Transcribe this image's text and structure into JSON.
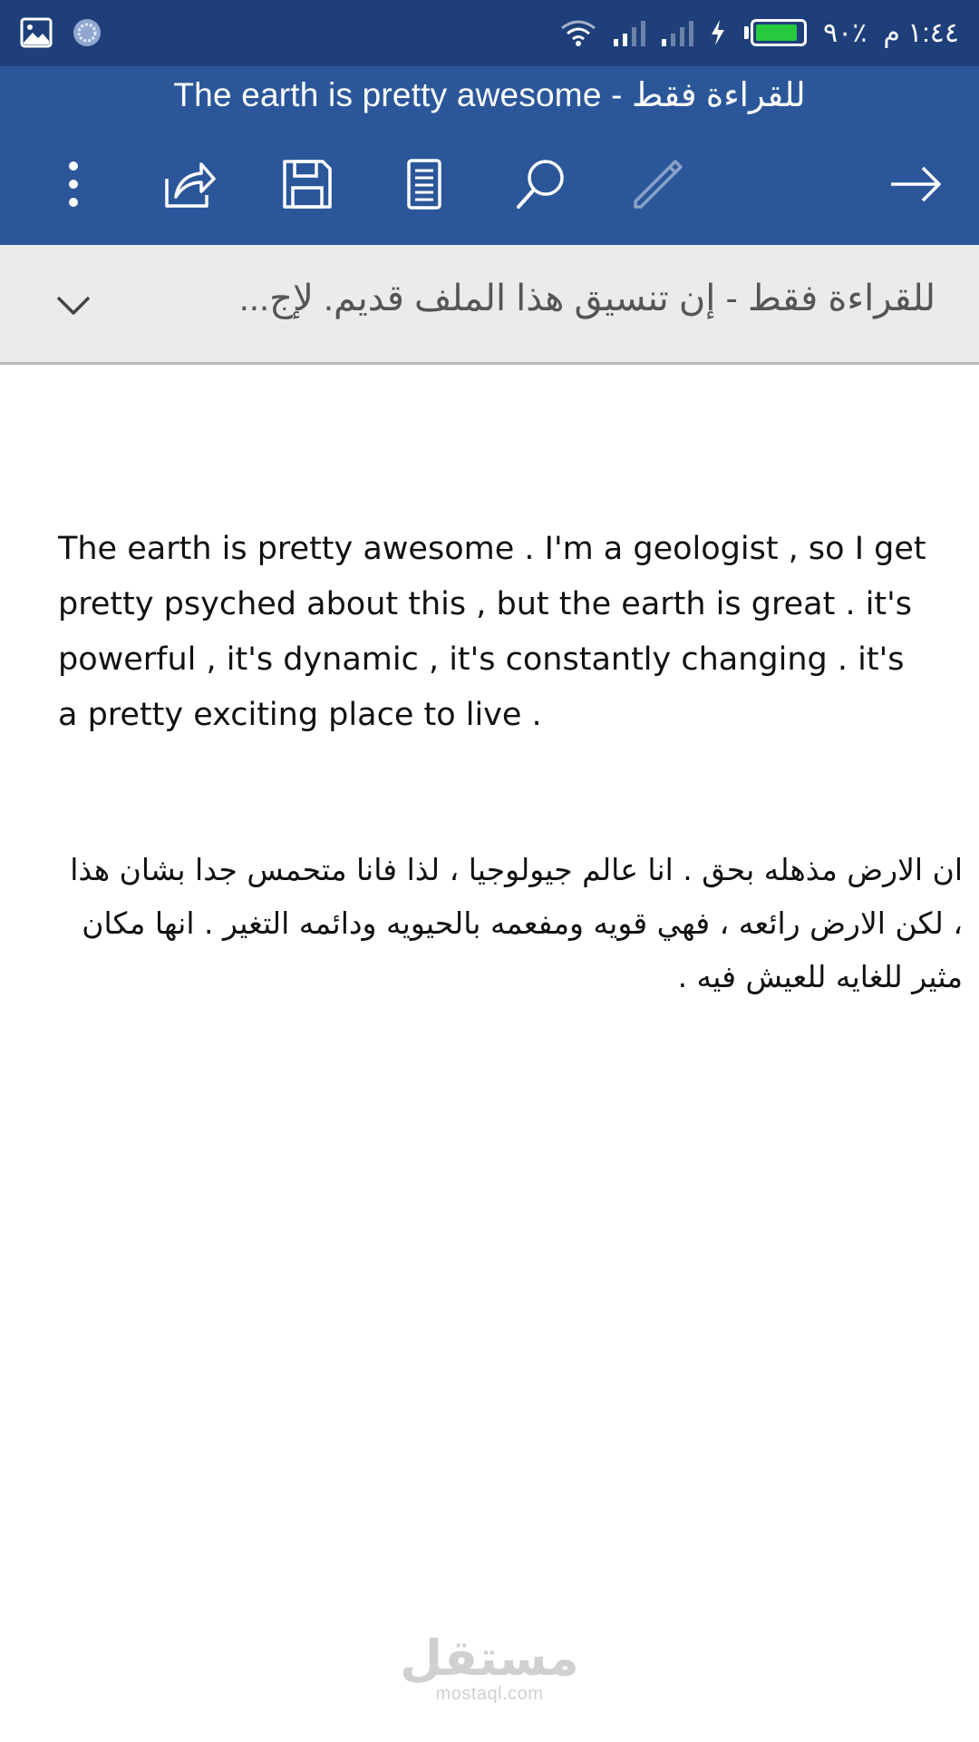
{
  "status_bar": {
    "time": "١:٤٤ م",
    "battery_percent": "٩٠٪",
    "battery_level": 0.9,
    "battery_color": "#27c93f",
    "icons": [
      "gallery-icon",
      "app-badge-icon",
      "wifi-icon",
      "signal-icon",
      "charging-icon",
      "battery-icon"
    ]
  },
  "app_bar": {
    "title": "The earth is pretty awesome - للقراءة فقط",
    "color": "#2b579a",
    "toolbar_icons": [
      "more-options-icon",
      "share-icon",
      "save-icon",
      "mobile-view-icon",
      "search-icon",
      "edit-icon",
      "back-arrow-icon"
    ]
  },
  "readonly_banner": {
    "message": "للقراءة فقط - إن تنسيق هذا الملف قديم. لإج..."
  },
  "document": {
    "paragraph_en": "The earth is pretty awesome . I'm a geologist , so I get pretty psyched about this , but the earth is great . it's powerful , it's dynamic , it's constantly changing . it's a pretty exciting place to live .",
    "paragraph_ar": "ان الارض مذهله بحق . انا عالم جيولوجيا ، لذا فانا متحمس جدا بشان هذا ، لكن الارض رائعه ، فهي قويه ومفعمه بالحيويه ودائمه التغير . انها مكان مثير للغايه للعيش فيه ."
  },
  "watermark": {
    "name_ar": "مستقل",
    "domain": "mostaql.com"
  }
}
